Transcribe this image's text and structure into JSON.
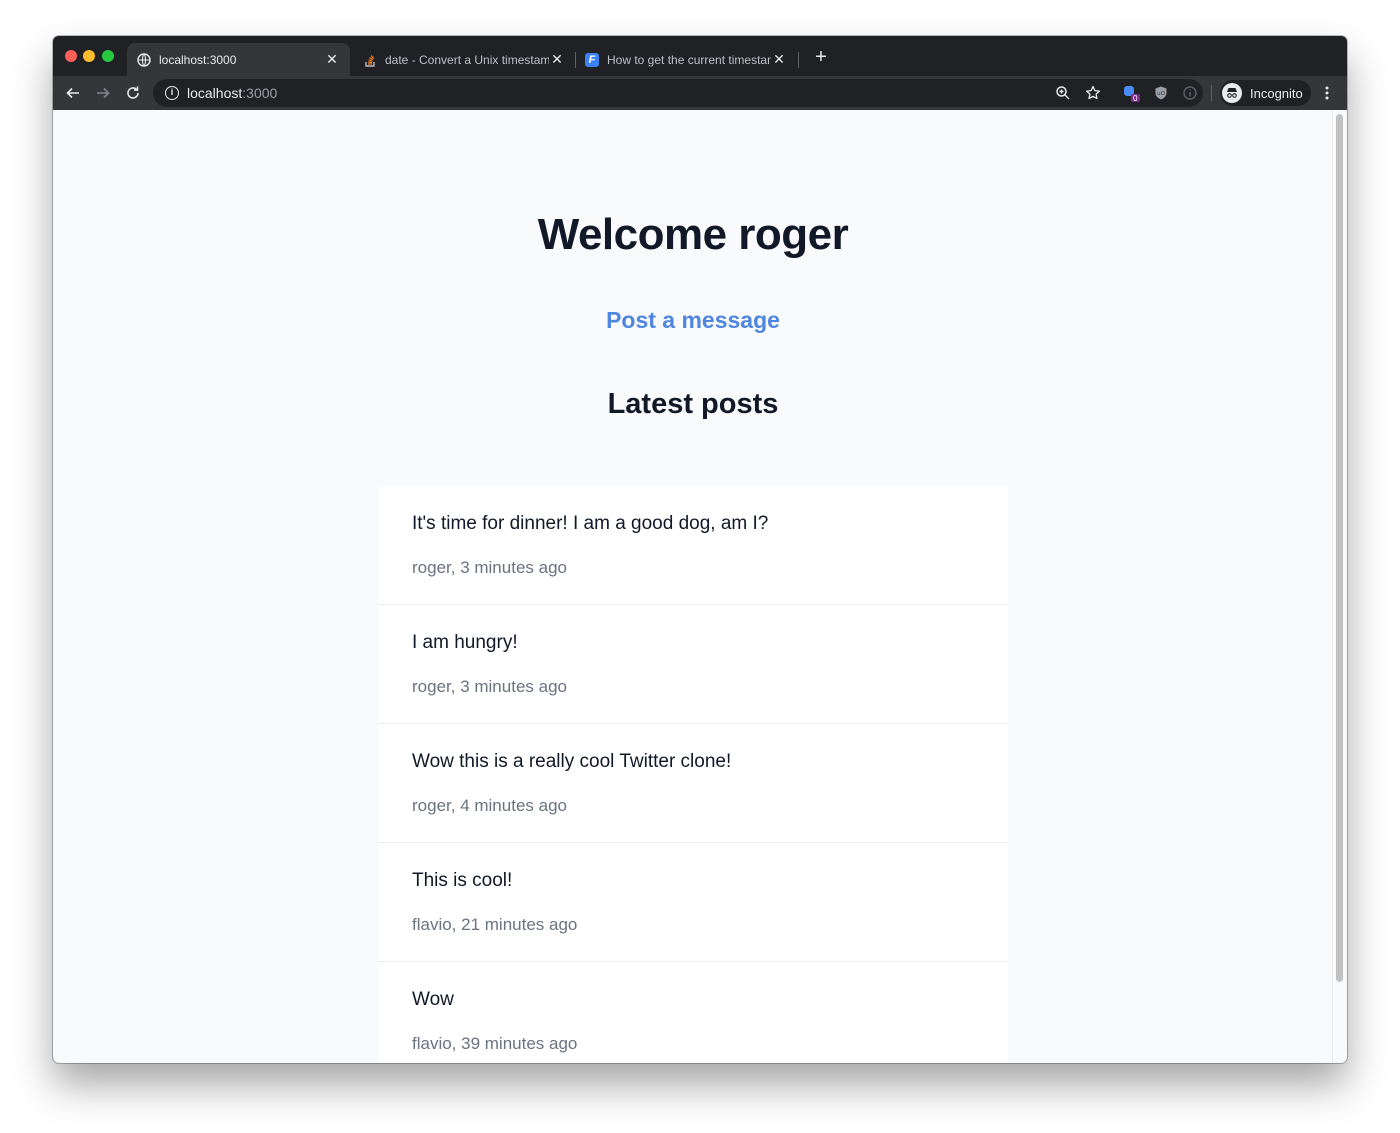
{
  "browser": {
    "tabs": [
      {
        "title": "localhost:3000",
        "icon": "globe-icon",
        "active": true
      },
      {
        "title": "date - Convert a Unix timestamp",
        "icon": "stackoverflow-icon",
        "active": false
      },
      {
        "title": "How to get the current timestamp",
        "icon": "flavio-icon",
        "active": false
      }
    ],
    "address": {
      "host": "localhost",
      "port": ":3000"
    },
    "extension_badge": "0",
    "profile_label": "Incognito"
  },
  "page": {
    "heading": "Welcome roger",
    "post_link": "Post a message",
    "latest_heading": "Latest posts",
    "posts": [
      {
        "message": "It's time for dinner! I am a good dog, am I?",
        "meta": "roger, 3 minutes ago"
      },
      {
        "message": "I am hungry!",
        "meta": "roger, 3 minutes ago"
      },
      {
        "message": "Wow this is a really cool Twitter clone!",
        "meta": "roger, 4 minutes ago"
      },
      {
        "message": "This is cool!",
        "meta": "flavio, 21 minutes ago"
      },
      {
        "message": "Wow",
        "meta": "flavio, 39 minutes ago"
      }
    ]
  },
  "colors": {
    "link": "#4f86e0",
    "heading": "#111827",
    "meta": "#6b7280",
    "background": "#f9fafb"
  }
}
